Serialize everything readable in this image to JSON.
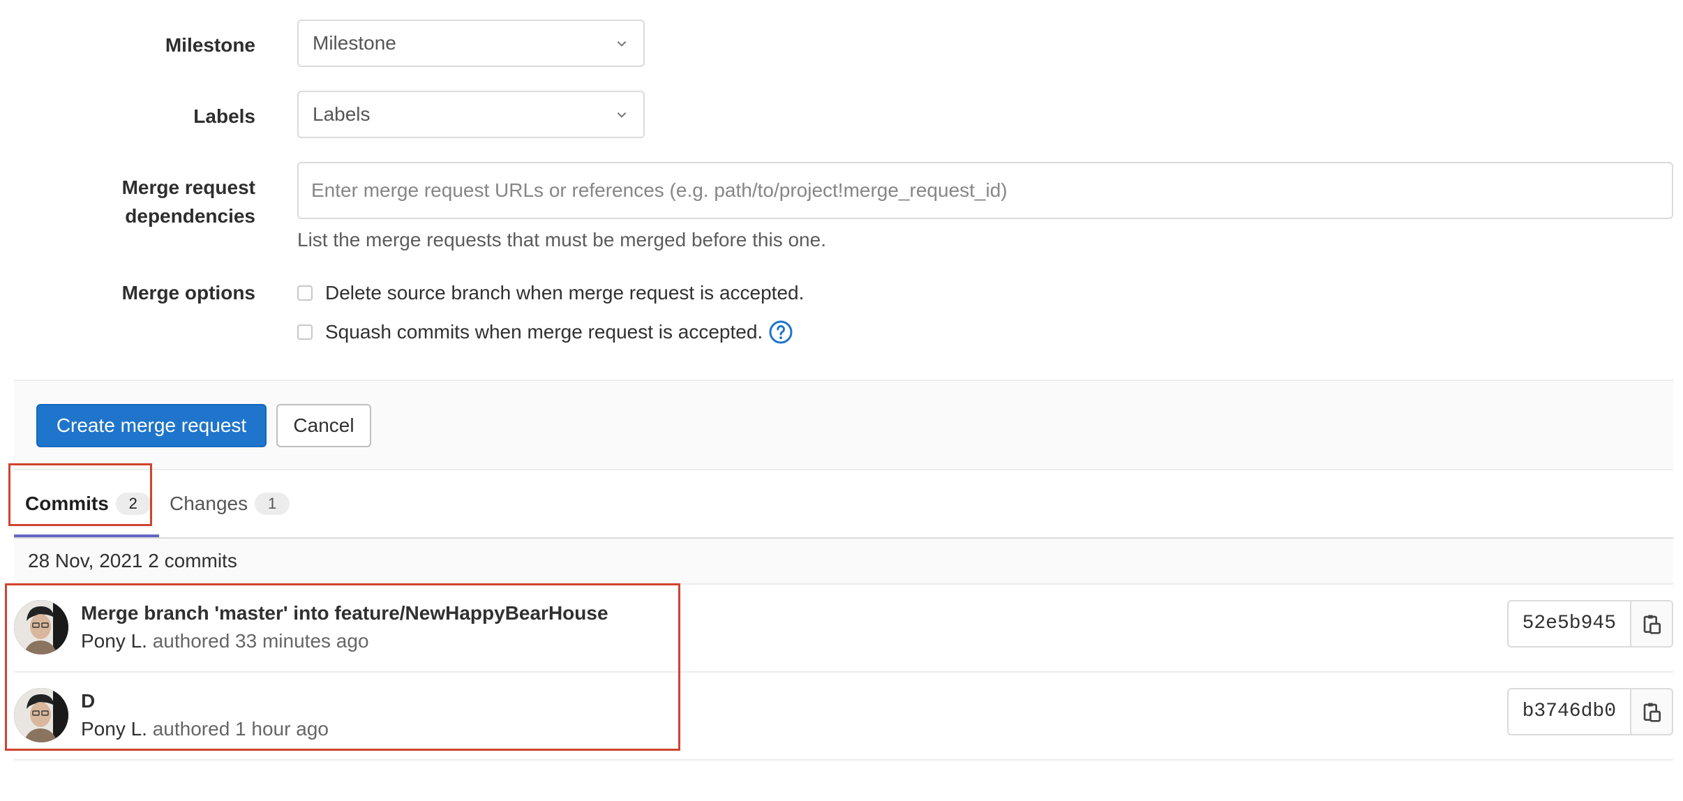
{
  "form": {
    "milestone": {
      "label": "Milestone",
      "value": "Milestone"
    },
    "labels": {
      "label": "Labels",
      "value": "Labels"
    },
    "dependencies": {
      "label_line1": "Merge request",
      "label_line2": "dependencies",
      "placeholder": "Enter merge request URLs or references (e.g. path/to/project!merge_request_id)",
      "help": "List the merge requests that must be merged before this one."
    },
    "merge_options": {
      "label": "Merge options",
      "delete_source": "Delete source branch when merge request is accepted.",
      "squash": "Squash commits when merge request is accepted."
    }
  },
  "actions": {
    "create": "Create merge request",
    "cancel": "Cancel"
  },
  "tabs": [
    {
      "label": "Commits",
      "count": "2"
    },
    {
      "label": "Changes",
      "count": "1"
    }
  ],
  "commits": {
    "group_header": "28 Nov, 2021 2 commits",
    "items": [
      {
        "title": "Merge branch 'master' into feature/NewHappyBearHouse",
        "author": "Pony L.",
        "when": "authored 33 minutes ago",
        "sha": "52e5b945"
      },
      {
        "title": "D",
        "author": "Pony L.",
        "when": "authored 1 hour ago",
        "sha": "b3746db0"
      }
    ]
  },
  "colors": {
    "primary": "#1f75cb",
    "highlight": "#d0432f",
    "tab_active": "#6666c4"
  }
}
